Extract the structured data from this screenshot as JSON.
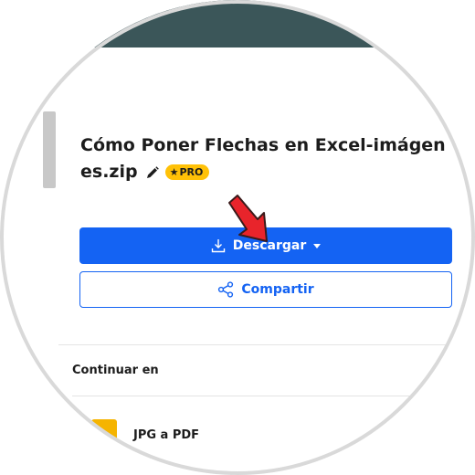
{
  "file": {
    "title_line1": "Cómo Poner Flechas en Excel-imágen",
    "title_line2": "es.zip",
    "badge": "PRO"
  },
  "actions": {
    "download_label": "Descargar",
    "share_label": "Compartir"
  },
  "continue": {
    "heading": "Continuar en",
    "items": [
      {
        "label": "JPG a PDF",
        "icon": "file-icon"
      }
    ]
  },
  "colors": {
    "topbar": "#3b5659",
    "primary": "#1463f3",
    "badge": "#ffc107",
    "annotation_arrow": "#e8242b",
    "tool_icon": "#f5b400"
  }
}
